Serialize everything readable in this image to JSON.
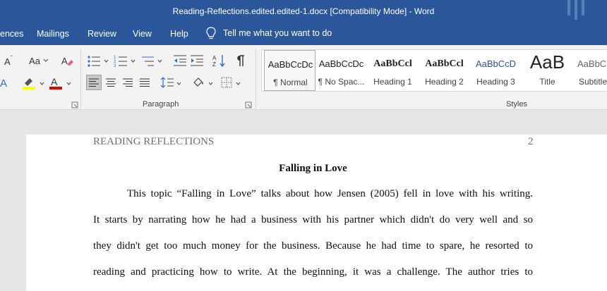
{
  "titlebar": {
    "title": "Reading-Reflections.edited.edited-1.docx [Compatibility Mode]  -  Word"
  },
  "tabs": [
    "ences",
    "Mailings",
    "Review",
    "View",
    "Help"
  ],
  "tellme": {
    "label": "Tell me what you want to do"
  },
  "groups": {
    "paragraph": "Paragraph",
    "styles": "Styles"
  },
  "font_buttons": {
    "change_case": "Aa"
  },
  "styles": [
    {
      "preview": "AaBbCcDc",
      "name": "¶ Normal"
    },
    {
      "preview": "AaBbCcDc",
      "name": "¶ No Spac..."
    },
    {
      "preview": "AaBbCcl",
      "name": "Heading 1"
    },
    {
      "preview": "AaBbCcl",
      "name": "Heading 2"
    },
    {
      "preview": "AaBbCcD",
      "name": "Heading 3"
    },
    {
      "preview": "AaB",
      "name": "Title"
    },
    {
      "preview": "AaBbCcD",
      "name": "Subtitle"
    }
  ],
  "document": {
    "header_text": "READING REFLECTIONS",
    "page_number": "2",
    "heading": "Falling in Love",
    "lines": [
      "This topic “Falling in Love” talks about how Jensen (2005) fell in love with his writing.",
      "It starts by narrating how he had a business with his partner which didn't do very well and so",
      "they didn't get too much money for the business. Because he had time to spare, he resorted to",
      "reading and practicing how to write. At the beginning, it was a challenge. The author tries to"
    ]
  },
  "colors": {
    "word_blue": "#2b579a",
    "highlight": "#ffff00",
    "font_color": "#e00000"
  }
}
